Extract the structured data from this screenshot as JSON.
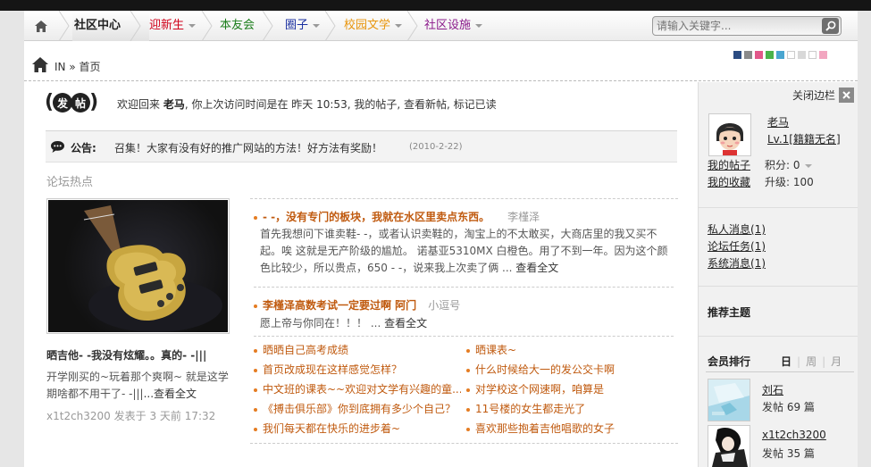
{
  "nav": {
    "items": [
      {
        "label": "社区中心",
        "color": "#222222",
        "caret": false
      },
      {
        "label": "迎新生",
        "color": "#d0021b",
        "caret": true
      },
      {
        "label": "本友会",
        "color": "#1a7d1a",
        "caret": false
      },
      {
        "label": "圈子",
        "color": "#1a2fa0",
        "caret": true
      },
      {
        "label": "校园文学",
        "color": "#e8950c",
        "caret": true
      },
      {
        "label": "社区设施",
        "color": "#8b1a8b",
        "caret": true
      }
    ],
    "search_placeholder": "请输入关键字..."
  },
  "breadcrumb": {
    "text": "IN » 首页"
  },
  "swatches": [
    "#2b4c82",
    "#8a8a8a",
    "#e2588a",
    "#4bb34b",
    "#4aa6d0",
    "#ffffff",
    "#d8d8d8",
    "#ffffff",
    "#f2a6c0"
  ],
  "post_logo": {
    "left": "(",
    "c1": "发",
    "c2": "帖",
    "right": ")"
  },
  "welcome": {
    "prefix": "欢迎回来",
    "username": "老马",
    "middle": ", 你上次访问时间是在 昨天 10:53,",
    "my_posts": "我的帖子,",
    "new_posts": "查看新帖,",
    "mark_read": "标记已读"
  },
  "notice": {
    "label": "公告:",
    "text": "召集！大家有没有好的推广网站的方法！好方法有奖励！",
    "date": "(2010-2-22)"
  },
  "hot": {
    "title": "论坛热点",
    "featured": {
      "title": "晒吉他- -我没有炫耀。。真的- -|||",
      "desc": "开学刚买的~玩着那个爽啊~ 就是这学期啥都不用干了- -|||",
      "more": "...查看全文",
      "meta": "x1t2ch3200 发表于 3 天前 17:32"
    },
    "top1": {
      "title": "- -，没有专门的板块，我就在水区里卖点东西。",
      "author": "李槿泽",
      "desc": "首先我想问下谁卖鞋- -，或者认识卖鞋的，淘宝上的不太敢买，大商店里的我又买不起。唉 这就是无产阶级的尴尬。 诺基亚5310MX 白橙色。用了不到一年。因为这个颜色比较少，所以贵点，650 - -，说来我上次卖了俩 ...",
      "more": "查看全文"
    },
    "top2": {
      "title": "李槿泽高数考试一定要过啊 阿门",
      "author": "小逗号",
      "desc": "愿上帝与你同在！！！ ...",
      "more": "查看全文"
    },
    "list": [
      "晒晒自己高考成绩",
      "晒课表~",
      "首页改成现在这样感觉怎样？",
      "什么时候给大一的发公交卡啊",
      "中文班的课表~~欢迎对文学有兴趣的童...",
      "对学校这个网速啊，咱算是",
      "《搏击俱乐部》你到底拥有多少个自己？",
      "11号楼的女生都走光了",
      "我们每天都在快乐的进步着~",
      "喜欢那些抱着吉他唱歌的女子"
    ]
  },
  "sidebar": {
    "close_label": "关闭边栏",
    "user": {
      "name": "老马",
      "level": "Lv.1[籍籍无名]",
      "my_posts": "我的帖子",
      "my_favs": "我的收藏",
      "points": "积分: 0",
      "upgrade": "升级: 100"
    },
    "links": {
      "pm": "私人消息(1)",
      "task": "论坛任务(1)",
      "sys": "系统消息(1)"
    },
    "recommend_title": "推荐主题",
    "rank": {
      "title": "会员排行",
      "tab_day": "日",
      "tab_week": "周",
      "tab_month": "月",
      "members": [
        {
          "name": "刘石",
          "posts": "发帖 69 篇"
        },
        {
          "name": "x1t2ch3200",
          "posts": "发帖 35 篇"
        }
      ]
    }
  }
}
